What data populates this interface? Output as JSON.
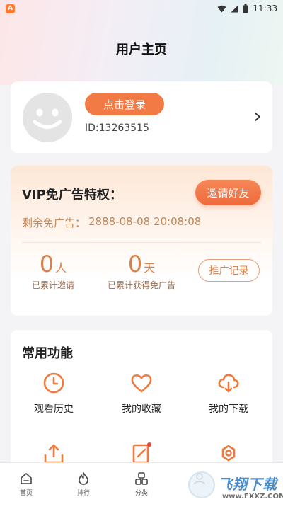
{
  "status_bar": {
    "time": "11:33",
    "app_icon_letter": "A"
  },
  "header": {
    "title": "用户主页"
  },
  "profile": {
    "login_label": "点击登录",
    "user_id": "ID:13263515"
  },
  "vip": {
    "title": "VIP免广告特权：",
    "invite_label": "邀请好友",
    "remain_label": "剩余免广告：",
    "remain_value": "2888-08-08 20:08:08",
    "invited_count": "0",
    "invited_unit": "人",
    "invited_label": "已累计邀请",
    "days_count": "0",
    "days_unit": "天",
    "days_label": "已累计获得免广告",
    "record_label": "推广记录"
  },
  "functions": {
    "title": "常用功能",
    "items": [
      {
        "label": "观看历史",
        "icon": "clock-icon"
      },
      {
        "label": "我的收藏",
        "icon": "heart-icon"
      },
      {
        "label": "我的下载",
        "icon": "cloud-download-icon"
      },
      {
        "label": "",
        "icon": "upload-icon"
      },
      {
        "label": "",
        "icon": "edit-icon"
      },
      {
        "label": "",
        "icon": "settings-icon"
      }
    ]
  },
  "tabbar": {
    "items": [
      {
        "label": "首页",
        "icon": "home-icon"
      },
      {
        "label": "排行",
        "icon": "flame-icon"
      },
      {
        "label": "分类",
        "icon": "category-icon"
      },
      {
        "label": "",
        "icon": "profile-icon"
      }
    ]
  },
  "watermark": {
    "brand": "飞翔下载",
    "url": "www.FXXZ.COM"
  },
  "colors": {
    "accent": "#f27a45",
    "vip_text": "#d9814b",
    "watermark": "#2b78c2"
  }
}
